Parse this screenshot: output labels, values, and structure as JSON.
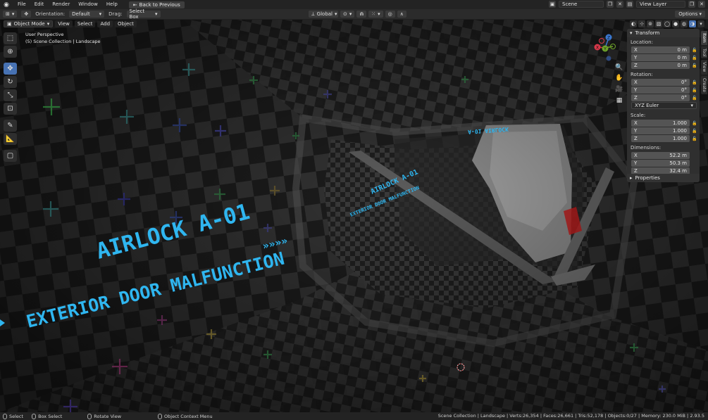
{
  "menubar": {
    "items": [
      "File",
      "Edit",
      "Render",
      "Window",
      "Help"
    ],
    "back_button": "Back to Previous",
    "scene": "Scene",
    "view_layer": "View Layer"
  },
  "toolheader": {
    "orientation_label": "Orientation:",
    "orientation_value": "Default",
    "drag_label": "Drag:",
    "drag_value": "Select Box",
    "transform_orientation": "Global",
    "options": "Options"
  },
  "viewport_header": {
    "mode": "Object Mode",
    "menus": [
      "View",
      "Select",
      "Add",
      "Object"
    ]
  },
  "viewport": {
    "perspective": "User Perspective",
    "collection": "(5) Scene Collection | Landscape",
    "signs": {
      "airlock_big": "AIRLOCK A-01",
      "door_big": "EXTERIOR DOOR MALFUNCTION",
      "arrows": "»»»»",
      "airlock_small": "AIRLOCK A-01",
      "door_small": "EXTERIOR DOOR MALFUNCTION",
      "mirrored": "A-01 AIRLOCK"
    }
  },
  "gizmo": {
    "x": "X",
    "y": "Y",
    "z": "Z"
  },
  "npanel": {
    "transform_title": "Transform",
    "location_label": "Location:",
    "location": [
      {
        "axis": "X",
        "value": "0 m"
      },
      {
        "axis": "Y",
        "value": "0 m"
      },
      {
        "axis": "Z",
        "value": "0 m"
      }
    ],
    "rotation_label": "Rotation:",
    "rotation": [
      {
        "axis": "X",
        "value": "0°"
      },
      {
        "axis": "Y",
        "value": "0°"
      },
      {
        "axis": "Z",
        "value": "0°"
      }
    ],
    "rotation_mode": "XYZ Euler",
    "scale_label": "Scale:",
    "scale": [
      {
        "axis": "X",
        "value": "1.000"
      },
      {
        "axis": "Y",
        "value": "1.000"
      },
      {
        "axis": "Z",
        "value": "1.000"
      }
    ],
    "dimensions_label": "Dimensions:",
    "dimensions": [
      {
        "axis": "X",
        "value": "52.2 m"
      },
      {
        "axis": "Y",
        "value": "50.3 m"
      },
      {
        "axis": "Z",
        "value": "32.4 m"
      }
    ],
    "properties_title": "Properties"
  },
  "sidetabs": [
    "Item",
    "Tool",
    "View",
    "Create"
  ],
  "statusbar": {
    "select": "Select",
    "box_select": "Box Select",
    "rotate_view": "Rotate View",
    "context_menu": "Object Context Menu",
    "stats": "Scene Collection | Landscape | Verts:26,354 | Faces:26,661 | Tris:52,178 | Objects:0/27 | Memory: 230.0 MiB | 2.93.5"
  },
  "colors": {
    "accent": "#4772b3",
    "sign_cyan": "#2fb6f0",
    "x_axis": "#d9384a",
    "y_axis": "#6ea32a",
    "z_axis": "#3a78d0"
  }
}
